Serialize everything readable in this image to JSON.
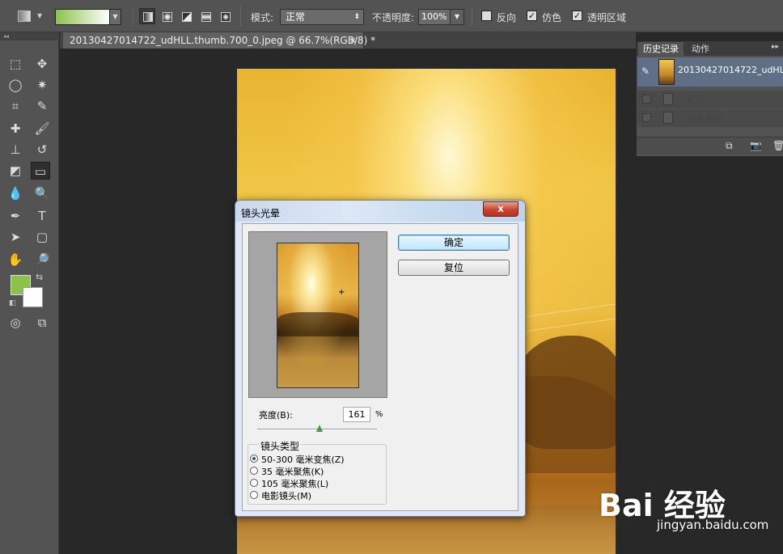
{
  "options": {
    "mode_label": "模式:",
    "mode_value": "正常",
    "opacity_label": "不透明度:",
    "opacity_value": "100%",
    "reverse_label": "反向",
    "dither_label": "仿色",
    "transparency_label": "透明区域",
    "gradient_colors": [
      "#8bc34a",
      "#ffffff"
    ]
  },
  "colors": {
    "foreground": "#8bc34a",
    "background": "#ffffff"
  },
  "document": {
    "tab_label": "20130427014722_udHLL.thumb.700_0.jpeg @ 66.7%(RGB/8) *",
    "close": "×"
  },
  "history": {
    "tabs": [
      "历史记录",
      "动作"
    ],
    "snapshot_label": "20130427014722_udHLL...",
    "states": [
      "打开",
      "镜头光晕"
    ]
  },
  "dialog": {
    "title": "镜头光晕",
    "close": "x",
    "ok": "确定",
    "reset": "复位",
    "brightness_label": "亮度(B):",
    "brightness_value": "161",
    "percent": "%",
    "brightness_level": 161,
    "lens_group_title": "镜头类型",
    "lens_options": [
      {
        "label": "50-300 毫米变焦(Z)",
        "selected": true
      },
      {
        "label": "35 毫米聚焦(K)",
        "selected": false
      },
      {
        "label": "105 毫米聚焦(L)",
        "selected": false
      },
      {
        "label": "电影镜头(M)",
        "selected": false
      }
    ]
  },
  "watermark": {
    "brand": "Bai 经验",
    "url": "jingyan.baidu.com"
  }
}
